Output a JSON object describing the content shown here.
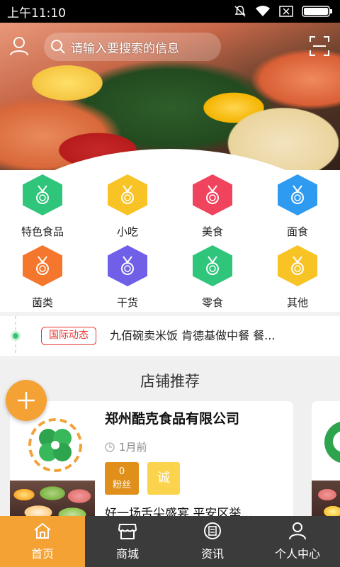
{
  "status_bar": {
    "time": "上午11:10"
  },
  "search": {
    "placeholder": "请输入要搜索的信息"
  },
  "categories": [
    {
      "label": "特色食品",
      "color": "#2fc57a"
    },
    {
      "label": "小吃",
      "color": "#f7c325"
    },
    {
      "label": "美食",
      "color": "#f0435e"
    },
    {
      "label": "面食",
      "color": "#2f9bf0"
    },
    {
      "label": "菌类",
      "color": "#f5772d"
    },
    {
      "label": "干货",
      "color": "#7060e8"
    },
    {
      "label": "零食",
      "color": "#2fc57a"
    },
    {
      "label": "其他",
      "color": "#f7c325"
    }
  ],
  "news": {
    "tag": "国际动态",
    "text": "九佰碗卖米饭 肯德基做中餐 餐..."
  },
  "shop_section": {
    "title": "店铺推荐",
    "cards": [
      {
        "name": "郑州酷克食品有限公司",
        "time": "1月前",
        "fans_count": "0",
        "fans_label": "粉丝",
        "badge": "诚",
        "description": "好一场舌尖盛宴 平安区举..."
      }
    ]
  },
  "bottom_nav": [
    {
      "label": "首页",
      "icon": "home-icon",
      "active": true
    },
    {
      "label": "商城",
      "icon": "shop-icon",
      "active": false
    },
    {
      "label": "资讯",
      "icon": "news-icon",
      "active": false
    },
    {
      "label": "个人中心",
      "icon": "person-icon",
      "active": false
    }
  ],
  "colors": {
    "accent": "#f5a234",
    "nav_bg": "#3b3b3b",
    "news_tag": "#e53935"
  }
}
